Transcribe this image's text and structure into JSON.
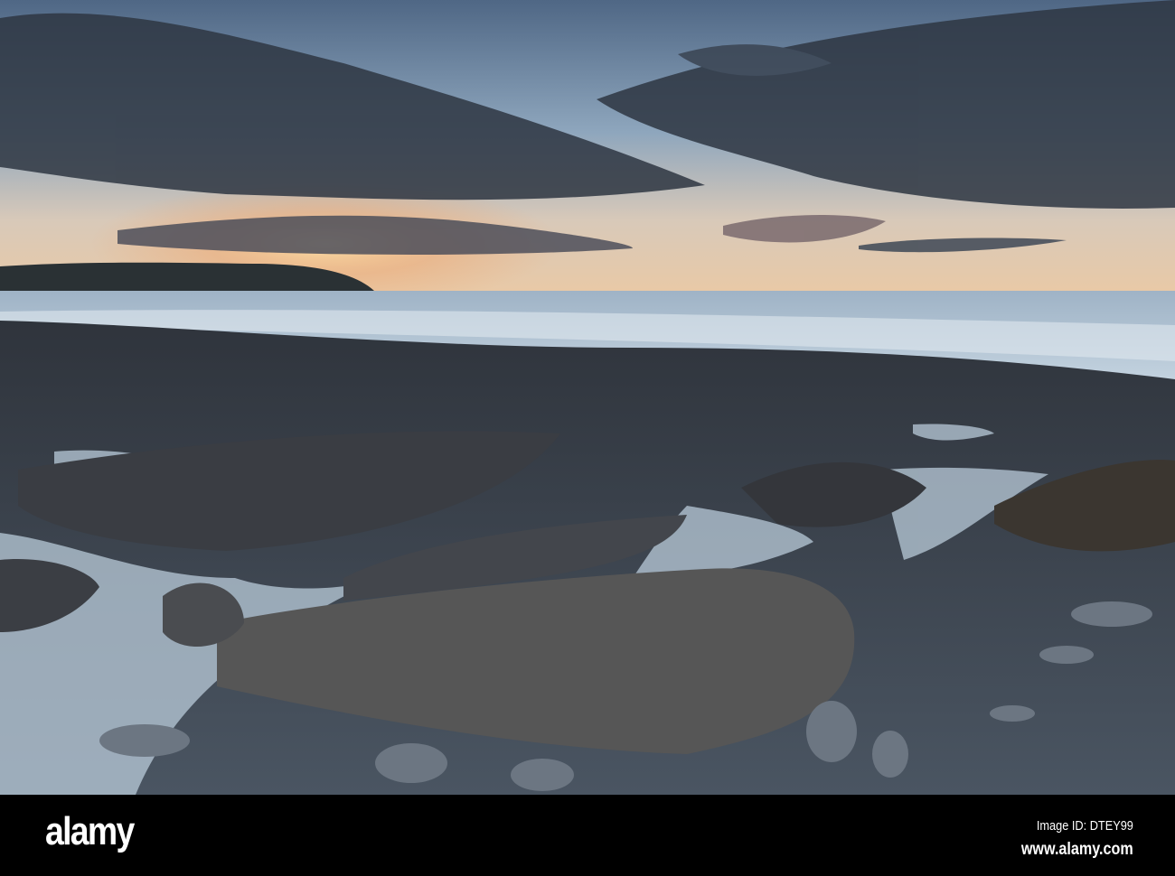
{
  "photo": {
    "subject": "rocky beach at sunset",
    "colors": {
      "sky_top": "#5d7690",
      "sky_glow": "#f2c58e",
      "sea": "#a9bccd",
      "rock": "#3b3f47"
    }
  },
  "footer": {
    "logo": "alamy",
    "image_id": "Image ID: DTEY99",
    "url": "www.alamy.com"
  }
}
